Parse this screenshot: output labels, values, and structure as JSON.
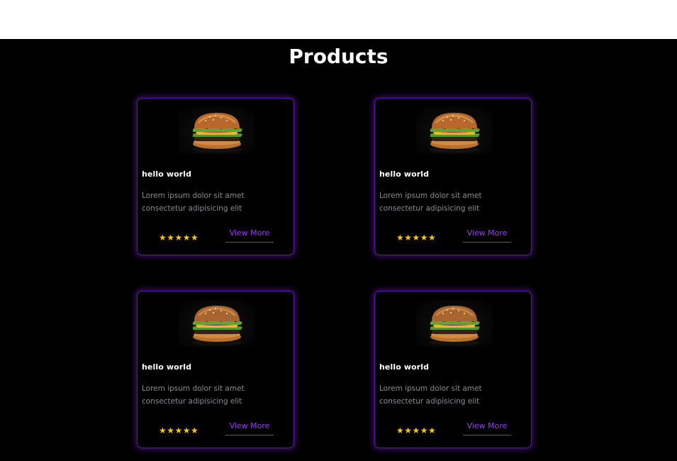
{
  "page": {
    "section_title": "Products",
    "colors": {
      "background": "#000000",
      "card_border": "#5b1aa6",
      "accent": "#9a3df0",
      "star": "#f5c518",
      "description": "#8b8b93"
    }
  },
  "products": [
    {
      "image_icon": "burger-image",
      "title": "hello world",
      "description": "Lorem ipsum dolor sit amet consectetur adipisicing elit",
      "rating": 5,
      "stars": "★★★★★",
      "button_label": "View More"
    },
    {
      "image_icon": "burger-image",
      "title": "hello world",
      "description": "Lorem ipsum dolor sit amet consectetur adipisicing elit",
      "rating": 5,
      "stars": "★★★★★",
      "button_label": "View More"
    },
    {
      "image_icon": "burger-image",
      "title": "hello world",
      "description": "Lorem ipsum dolor sit amet consectetur adipisicing elit",
      "rating": 5,
      "stars": "★★★★★",
      "button_label": "View More"
    },
    {
      "image_icon": "burger-image",
      "title": "hello world",
      "description": "Lorem ipsum dolor sit amet consectetur adipisicing elit",
      "rating": 5,
      "stars": "★★★★★",
      "button_label": "View More"
    }
  ]
}
